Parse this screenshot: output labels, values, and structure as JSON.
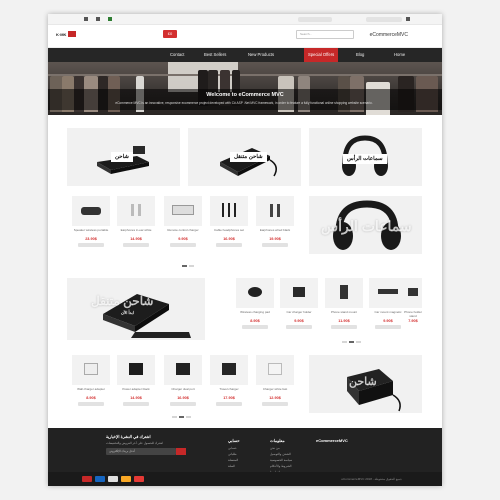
{
  "header": {
    "site_title": "eCommerceMVC",
    "logo_text": "K·MK",
    "cart_label": "£0",
    "search_placeholder": "Search..."
  },
  "nav": {
    "items": [
      "Special Offers",
      "New Products",
      "Best Sellers",
      "Contact",
      "Blog",
      "Home"
    ]
  },
  "hero": {
    "title": "Welcome to eCommerce MVC",
    "description": "eCommerce MVC is an innovative, responsive ecommerce project developed with C# ASP .Net MVC framework, in order to feature a fully functional online shopping website scenario."
  },
  "featured": [
    {
      "label": "شاحن"
    },
    {
      "label": "شاحن متنقل"
    },
    {
      "label": "سماعات الرأس"
    }
  ],
  "row1": {
    "promo_ghost": "سماعات الرأس",
    "products": [
      {
        "name": "Speaker wireless portable",
        "price": "23.90$"
      },
      {
        "name": "Earphones in-ear white",
        "price": "14.90$"
      },
      {
        "name": "Remote control charger",
        "price": "9.90$"
      },
      {
        "name": "Cable headphones set",
        "price": "16.90$"
      },
      {
        "name": "Earphones wired black",
        "price": "19.90$"
      }
    ]
  },
  "row2": {
    "promo_ghost": "شاحن متنقل",
    "promo_sub": "ابدأ الآن",
    "products": [
      {
        "name": "Wireless charging pad",
        "price": "8.90$"
      },
      {
        "name": "Car charger holder",
        "price": "9.90$"
      },
      {
        "name": "Phone stand mount",
        "price": "11.90$"
      },
      {
        "name": "Car mount magnetic",
        "price": "9.90$"
      },
      {
        "name": "Phone holder stand",
        "price": "7.90$"
      }
    ]
  },
  "row3": {
    "promo_ghost": "شاحن",
    "products": [
      {
        "name": "Wall charger adapter",
        "price": "8.90$"
      },
      {
        "name": "Power adapter black",
        "price": "14.90$"
      },
      {
        "name": "Charger dual port",
        "price": "16.90$"
      },
      {
        "name": "Travel charger",
        "price": "17.90$"
      },
      {
        "name": "Charger white fast",
        "price": "12.90$"
      }
    ]
  },
  "footer": {
    "brand": "eCommerceMVC",
    "info_title": "معلومات",
    "info_links": [
      "من نحن",
      "الشحن والتوصيل",
      "سياسة الخصوصية",
      "الشروط والأحكام",
      "اتصل بنا"
    ],
    "account_title": "حسابي",
    "account_links": [
      "حسابي",
      "طلباتي",
      "المفضلة",
      "السلة"
    ],
    "newsletter_title": "اشترك في النشرة الإخبارية",
    "newsletter_text": "اشترك للحصول على آخر العروض والتخفيضات",
    "newsletter_placeholder": "أدخل بريدك الإلكتروني",
    "copyright": "eCommerceMVC 2018 - جميع الحقوق محفوظة"
  },
  "colors": {
    "accent": "#c62828",
    "price": "#d32f2f",
    "nav_bg": "#262626",
    "footer_bg": "#222222"
  }
}
